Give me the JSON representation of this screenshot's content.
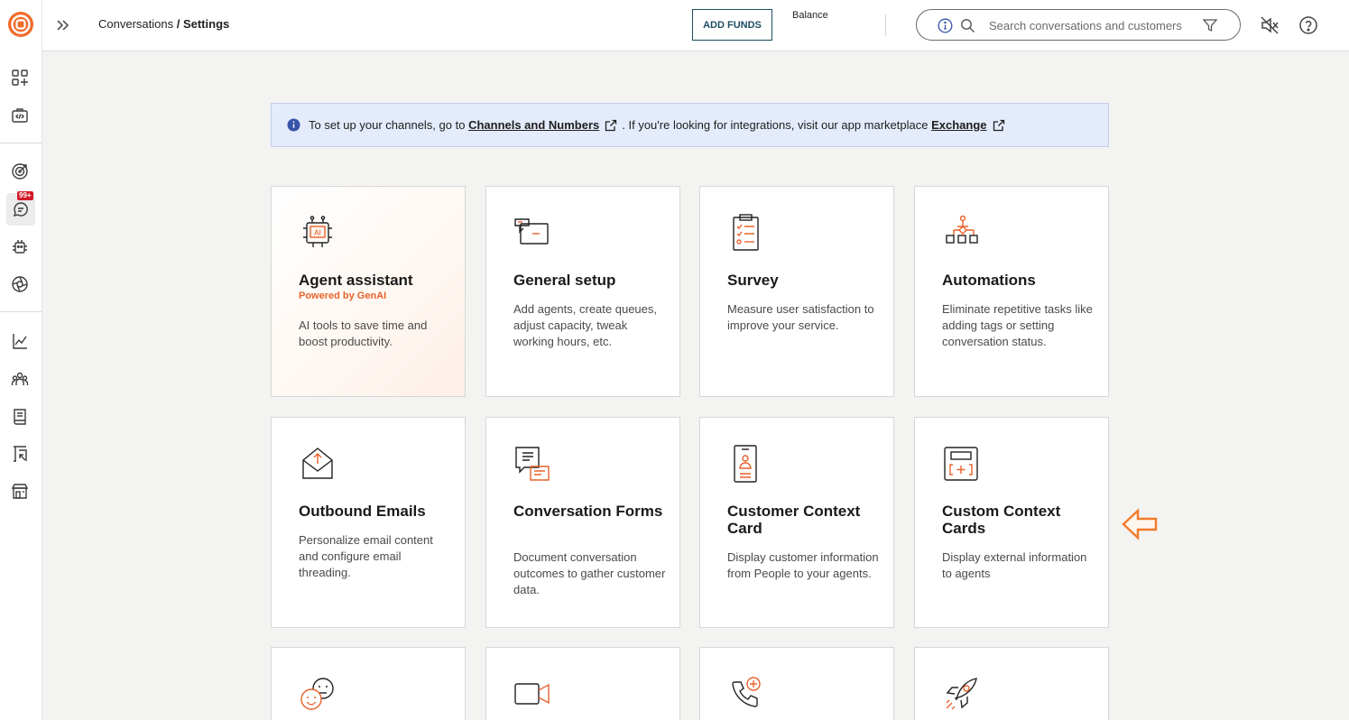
{
  "header": {
    "breadcrumb_parent": "Conversations",
    "breadcrumb_separator": " / ",
    "breadcrumb_current": "Settings",
    "add_funds_label": "ADD FUNDS",
    "balance_label": "Balance",
    "search_placeholder": "Search conversations and customers"
  },
  "sidebar": {
    "badge": "99+"
  },
  "banner": {
    "text_before": "To set up your channels, go to ",
    "link1": "Channels and Numbers",
    "text_middle": ". If you're looking for integrations, visit our app marketplace ",
    "link2": "Exchange"
  },
  "cards": [
    {
      "title": "Agent assistant",
      "subtitle": "Powered by GenAI",
      "description": "AI tools to save time and boost productivity.",
      "icon": "ai-robot-icon"
    },
    {
      "title": "General setup",
      "description": "Add agents, create queues, adjust capacity, tweak working hours, etc.",
      "icon": "general-setup-icon"
    },
    {
      "title": "Survey",
      "description": "Measure user satisfaction to improve your service.",
      "icon": "survey-clipboard-icon"
    },
    {
      "title": "Automations",
      "description": "Eliminate repetitive tasks like adding tags or setting conversation status.",
      "icon": "automation-flow-icon"
    },
    {
      "title": "Outbound Emails",
      "description": "Personalize email content and configure email threading.",
      "icon": "outbound-email-icon"
    },
    {
      "title": "Conversation Forms",
      "description": "Document conversation outcomes to gather customer data.",
      "icon": "conversation-forms-icon"
    },
    {
      "title": "Customer Context Card",
      "description": "Display customer information from People to your agents.",
      "icon": "customer-card-icon"
    },
    {
      "title": "Custom Context Cards",
      "description": "Display external information to agents",
      "icon": "custom-card-icon"
    },
    {
      "icon": "sentiment-faces-icon"
    },
    {
      "icon": "video-camera-icon"
    },
    {
      "icon": "phone-add-icon"
    },
    {
      "icon": "rocket-icon"
    }
  ],
  "colors": {
    "accent_orange": "#e9622c",
    "brand_dark": "#1f4d63",
    "banner_bg": "#e4ebfb"
  }
}
